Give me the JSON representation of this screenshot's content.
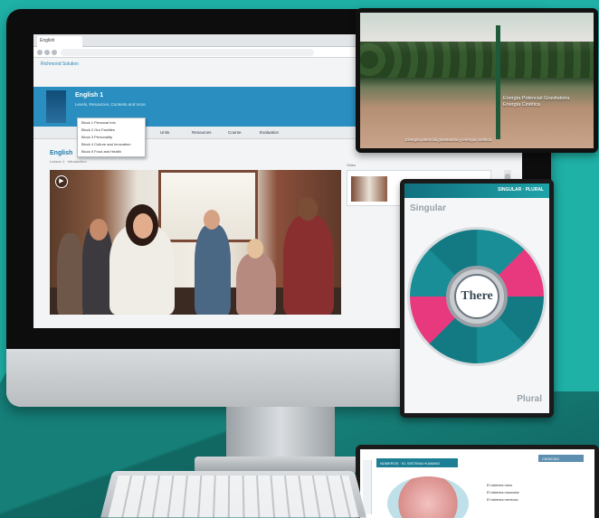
{
  "browser": {
    "tab_label": "English",
    "url": "",
    "app_sub": "Richmond Solution"
  },
  "course": {
    "title": "English 1",
    "subtitle": "Levels, Resources, Contents and more"
  },
  "menu": {
    "items": [
      "Units",
      "Resources",
      "Course",
      "Evaluation"
    ],
    "dropdown": [
      "Block 1 Personal Info",
      "Block 2 Our Families",
      "Block 3 Personality",
      "Block 4 Culture and Innovation",
      "Block 5 Food and Health"
    ]
  },
  "lesson": {
    "title": "English",
    "sub": "Lesson 1 · Introduction",
    "side_label": "Video"
  },
  "tablet_landscape": {
    "heading": "Energía Potencial Gravitatoria",
    "sub": "Energía Cinética",
    "caption": "Energía potencial gravitatoria y energía cinética"
  },
  "tablet_portrait": {
    "header": "SINGULAR · PLURAL",
    "singular": "Singular",
    "plural": "Plural",
    "center_word": "There"
  },
  "tablet_bottom": {
    "header_left": "NÚMEROS · EL SISTEMA HUMANO",
    "header_right": "CIENCIAS",
    "lines": [
      "El sistema óseo",
      "El sistema muscular",
      "El sistema nervioso"
    ]
  }
}
